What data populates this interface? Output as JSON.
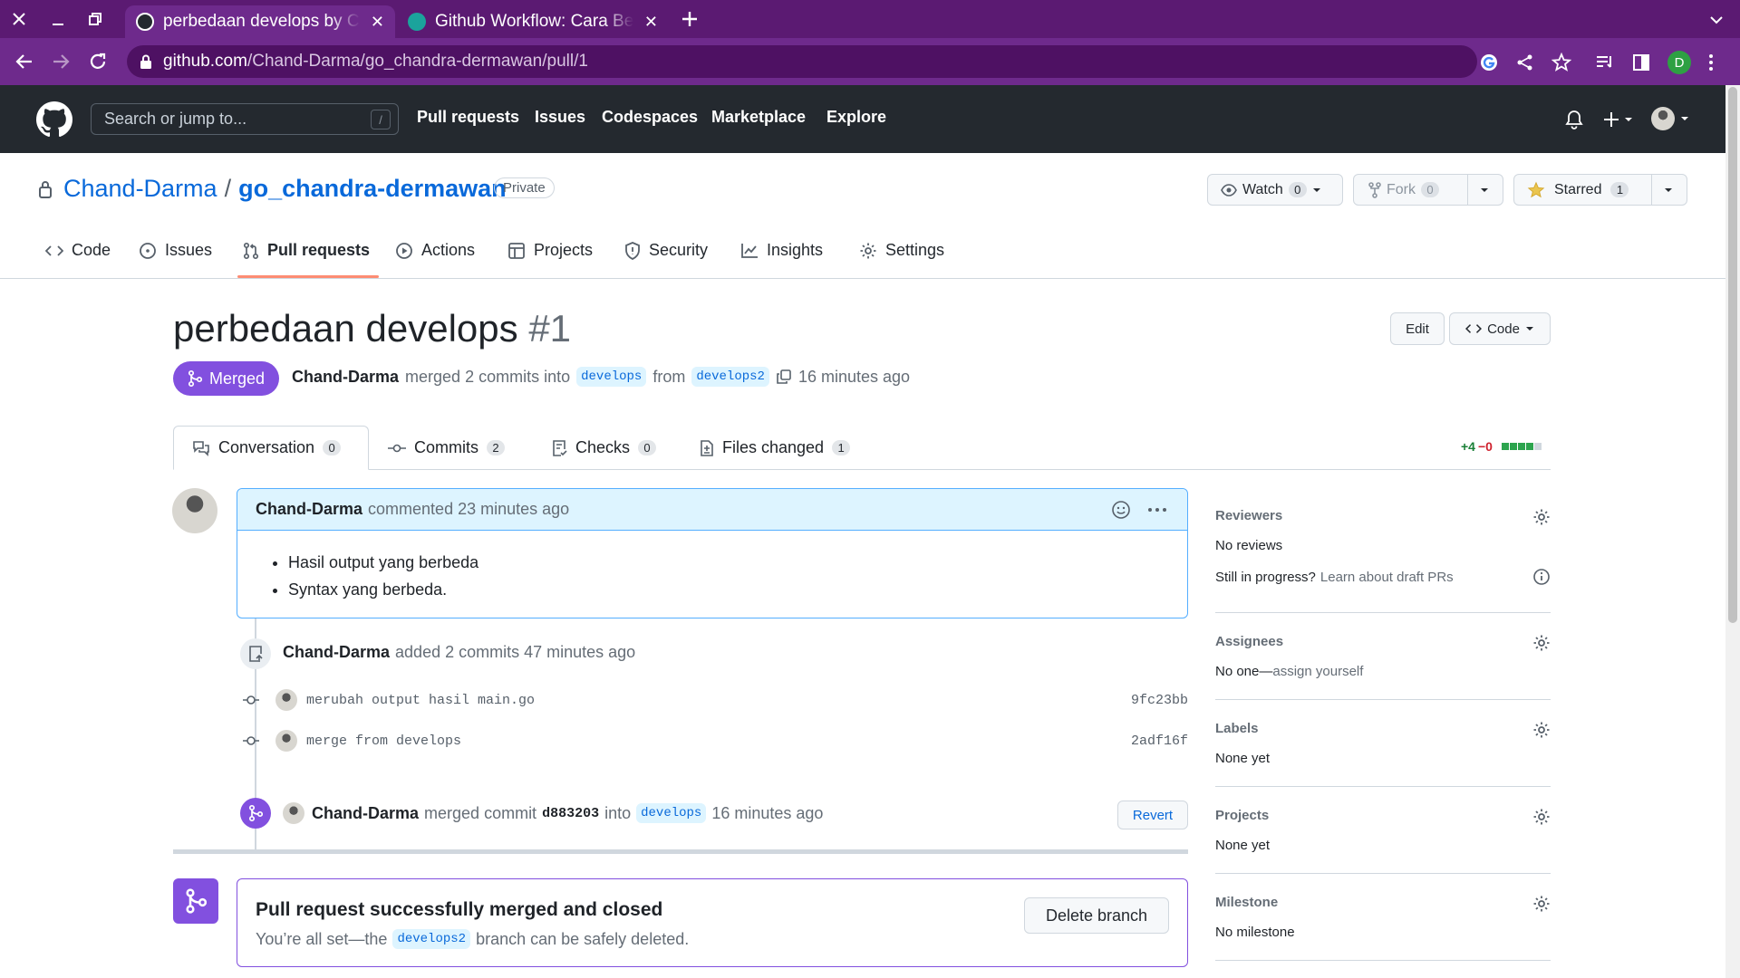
{
  "browser": {
    "tabs": [
      {
        "title": "perbedaan develops by Chand-Darma",
        "active": true
      },
      {
        "title": "Github Workflow: Cara Bekerja",
        "active": false
      }
    ],
    "url_host": "github.com",
    "url_path": "/Chand-Darma/go_chandra-dermawan/pull/1",
    "profile_initial": "D"
  },
  "github_header": {
    "search_placeholder": "Search or jump to...",
    "search_shortcut": "/",
    "nav": [
      "Pull requests",
      "Issues",
      "Codespaces",
      "Marketplace",
      "Explore"
    ]
  },
  "repo": {
    "owner": "Chand-Darma",
    "separator": "/",
    "name": "go_chandra-dermawan",
    "visibility": "Private",
    "watch_label": "Watch",
    "watch_count": "0",
    "fork_label": "Fork",
    "fork_count": "0",
    "star_label": "Starred",
    "star_count": "1",
    "tabs": [
      "Code",
      "Issues",
      "Pull requests",
      "Actions",
      "Projects",
      "Security",
      "Insights",
      "Settings"
    ]
  },
  "pr": {
    "title": "perbedaan develops",
    "number": "#1",
    "state": "Merged",
    "author": "Chand-Darma",
    "meta_action": "merged 2 commits into",
    "base_branch": "develops",
    "meta_from": "from",
    "head_branch": "develops2",
    "merged_ago": "16 minutes ago",
    "edit_label": "Edit",
    "code_label": "Code",
    "tabs": [
      {
        "label": "Conversation",
        "count": "0"
      },
      {
        "label": "Commits",
        "count": "2"
      },
      {
        "label": "Checks",
        "count": "0"
      },
      {
        "label": "Files changed",
        "count": "1"
      }
    ],
    "diffstat_add": "+4",
    "diffstat_del": "−0",
    "diffstat_blocks": [
      1,
      1,
      1,
      1,
      0
    ]
  },
  "comment": {
    "author": "Chand-Darma",
    "action": "commented 23 minutes ago",
    "items": [
      "Hasil output yang berbeda",
      "Syntax yang berbeda."
    ]
  },
  "timeline": {
    "commits_event": {
      "author": "Chand-Darma",
      "text": "added 2 commits 47 minutes ago"
    },
    "commits": [
      {
        "message": "merubah output hasil main.go",
        "sha": "9fc23bb"
      },
      {
        "message": "merge from develops",
        "sha": "2adf16f"
      }
    ],
    "merge_event": {
      "author": "Chand-Darma",
      "action": "merged commit",
      "sha": "d883203",
      "into": "into",
      "branch": "develops",
      "ago": "16 minutes ago",
      "revert_label": "Revert"
    }
  },
  "merged_box": {
    "title": "Pull request successfully merged and closed",
    "sub_prefix": "You’re all set—the",
    "branch": "develops2",
    "sub_suffix": "branch can be safely deleted.",
    "delete_label": "Delete branch"
  },
  "sidebar": {
    "reviewers": {
      "label": "Reviewers",
      "value": "No reviews",
      "progress_q": "Still in progress?",
      "progress_link": "Learn about draft PRs"
    },
    "assignees": {
      "label": "Assignees",
      "value_prefix": "No one—",
      "value_link": "assign yourself"
    },
    "labels": {
      "label": "Labels",
      "value": "None yet"
    },
    "projects": {
      "label": "Projects",
      "value": "None yet"
    },
    "milestone": {
      "label": "Milestone",
      "value": "No milestone"
    }
  },
  "colors": {
    "merged_purple": "#8250df",
    "link_blue": "#0969da",
    "browser_purple": "#5b1a72"
  }
}
